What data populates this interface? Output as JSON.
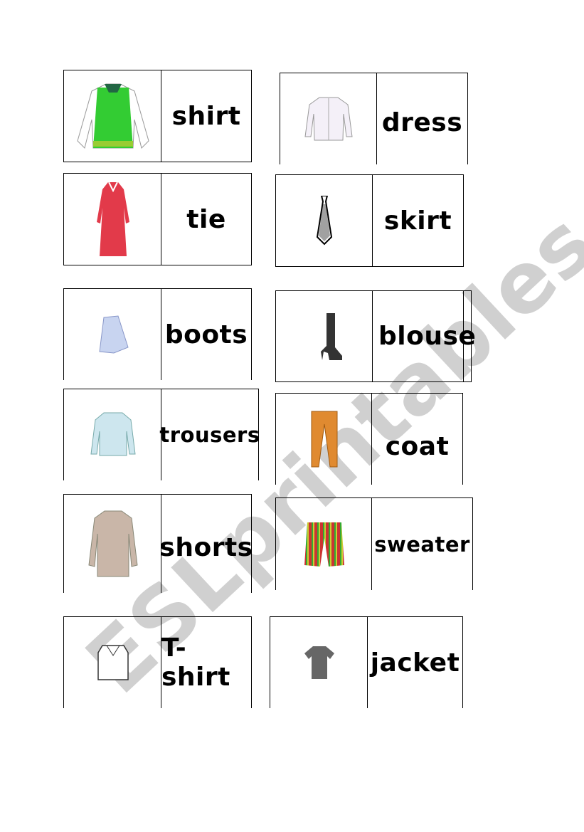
{
  "cards": [
    {
      "word": "shirt",
      "picture": "green-jacket"
    },
    {
      "word": "dress",
      "picture": "white-shirt"
    },
    {
      "word": "tie",
      "picture": "red-dress"
    },
    {
      "word": "skirt",
      "picture": "tie"
    },
    {
      "word": "boots",
      "picture": "blue-skirt"
    },
    {
      "word": "blouse",
      "picture": "black-boot"
    },
    {
      "word": "trousers",
      "picture": "light-blue-blouse"
    },
    {
      "word": "coat",
      "picture": "orange-trousers"
    },
    {
      "word": "shorts",
      "picture": "beige-coat"
    },
    {
      "word": "sweater",
      "picture": "striped-shorts"
    },
    {
      "word": "T-shirt",
      "picture": "white-sweater"
    },
    {
      "word": "jacket",
      "picture": "grey-t-shirt"
    }
  ],
  "watermark": "ESLprintables.com"
}
